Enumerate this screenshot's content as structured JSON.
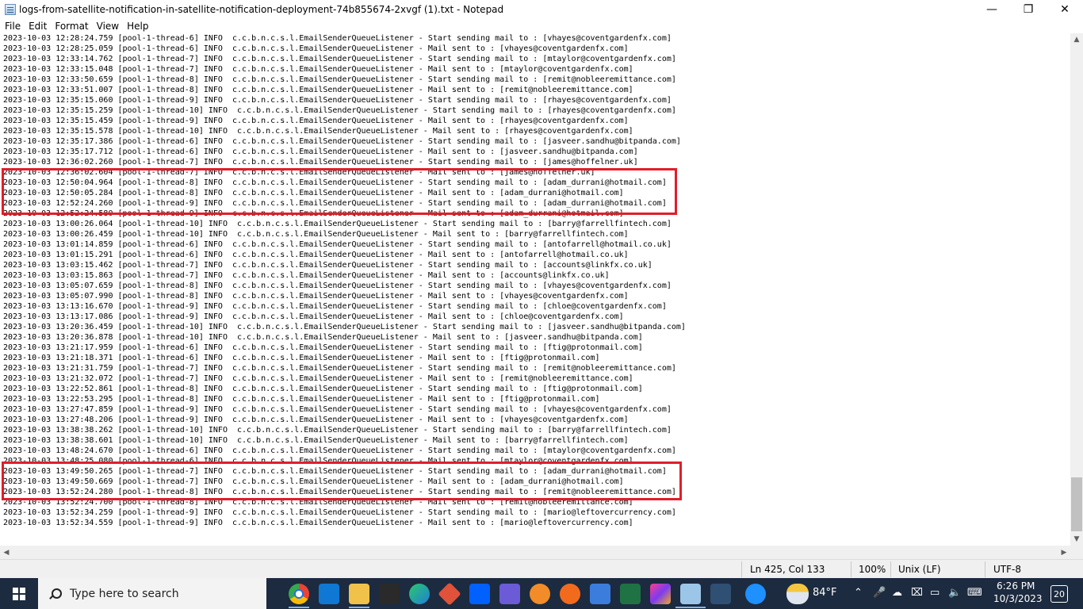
{
  "window": {
    "title": "logs-from-satellite-notification-in-satellite-notification-deployment-74b855674-2xvgf (1).txt - Notepad",
    "minimize_glyph": "—",
    "maximize_glyph": "❐",
    "close_glyph": "✕"
  },
  "menu": [
    "File",
    "Edit",
    "Format",
    "View",
    "Help"
  ],
  "lines": [
    "2023-10-03 12:28:24.759 [pool-1-thread-6] INFO  c.c.b.n.c.s.l.EmailSenderQueueListener - Start sending mail to : [vhayes@coventgardenfx.com]",
    "2023-10-03 12:28:25.059 [pool-1-thread-6] INFO  c.c.b.n.c.s.l.EmailSenderQueueListener - Mail sent to : [vhayes@coventgardenfx.com]",
    "2023-10-03 12:33:14.762 [pool-1-thread-7] INFO  c.c.b.n.c.s.l.EmailSenderQueueListener - Start sending mail to : [mtaylor@coventgardenfx.com]",
    "2023-10-03 12:33:15.048 [pool-1-thread-7] INFO  c.c.b.n.c.s.l.EmailSenderQueueListener - Mail sent to : [mtaylor@coventgardenfx.com]",
    "2023-10-03 12:33:50.659 [pool-1-thread-8] INFO  c.c.b.n.c.s.l.EmailSenderQueueListener - Start sending mail to : [remit@nobleeremittance.com]",
    "2023-10-03 12:33:51.007 [pool-1-thread-8] INFO  c.c.b.n.c.s.l.EmailSenderQueueListener - Mail sent to : [remit@nobleeremittance.com]",
    "2023-10-03 12:35:15.060 [pool-1-thread-9] INFO  c.c.b.n.c.s.l.EmailSenderQueueListener - Start sending mail to : [rhayes@coventgardenfx.com]",
    "2023-10-03 12:35:15.259 [pool-1-thread-10] INFO  c.c.b.n.c.s.l.EmailSenderQueueListener - Start sending mail to : [rhayes@coventgardenfx.com]",
    "2023-10-03 12:35:15.459 [pool-1-thread-9] INFO  c.c.b.n.c.s.l.EmailSenderQueueListener - Mail sent to : [rhayes@coventgardenfx.com]",
    "2023-10-03 12:35:15.578 [pool-1-thread-10] INFO  c.c.b.n.c.s.l.EmailSenderQueueListener - Mail sent to : [rhayes@coventgardenfx.com]",
    "2023-10-03 12:35:17.386 [pool-1-thread-6] INFO  c.c.b.n.c.s.l.EmailSenderQueueListener - Start sending mail to : [jasveer.sandhu@bitpanda.com]",
    "2023-10-03 12:35:17.712 [pool-1-thread-6] INFO  c.c.b.n.c.s.l.EmailSenderQueueListener - Mail sent to : [jasveer.sandhu@bitpanda.com]",
    "2023-10-03 12:36:02.260 [pool-1-thread-7] INFO  c.c.b.n.c.s.l.EmailSenderQueueListener - Start sending mail to : [james@hoffelner.uk]",
    "2023-10-03 12:36:02.604 [pool-1-thread-7] INFO  c.c.b.n.c.s.l.EmailSenderQueueListener - Mail sent to : [james@hoffelner.uk]",
    "2023-10-03 12:50:04.964 [pool-1-thread-8] INFO  c.c.b.n.c.s.l.EmailSenderQueueListener - Start sending mail to : [adam_durrani@hotmail.com]",
    "2023-10-03 12:50:05.284 [pool-1-thread-8] INFO  c.c.b.n.c.s.l.EmailSenderQueueListener - Mail sent to : [adam_durrani@hotmail.com]",
    "2023-10-03 12:52:24.260 [pool-1-thread-9] INFO  c.c.b.n.c.s.l.EmailSenderQueueListener - Start sending mail to : [adam_durrani@hotmail.com]",
    "2023-10-03 12:52:24.580 [pool-1-thread-9] INFO  c.c.b.n.c.s.l.EmailSenderQueueListener - Mail sent to : [adam_durrani@hotmail.com]",
    "2023-10-03 13:00:26.064 [pool-1-thread-10] INFO  c.c.b.n.c.s.l.EmailSenderQueueListener - Start sending mail to : [barry@farrellfintech.com]",
    "2023-10-03 13:00:26.459 [pool-1-thread-10] INFO  c.c.b.n.c.s.l.EmailSenderQueueListener - Mail sent to : [barry@farrellfintech.com]",
    "2023-10-03 13:01:14.859 [pool-1-thread-6] INFO  c.c.b.n.c.s.l.EmailSenderQueueListener - Start sending mail to : [antofarrell@hotmail.co.uk]",
    "2023-10-03 13:01:15.291 [pool-1-thread-6] INFO  c.c.b.n.c.s.l.EmailSenderQueueListener - Mail sent to : [antofarrell@hotmail.co.uk]",
    "2023-10-03 13:03:15.462 [pool-1-thread-7] INFO  c.c.b.n.c.s.l.EmailSenderQueueListener - Start sending mail to : [accounts@linkfx.co.uk]",
    "2023-10-03 13:03:15.863 [pool-1-thread-7] INFO  c.c.b.n.c.s.l.EmailSenderQueueListener - Mail sent to : [accounts@linkfx.co.uk]",
    "2023-10-03 13:05:07.659 [pool-1-thread-8] INFO  c.c.b.n.c.s.l.EmailSenderQueueListener - Start sending mail to : [vhayes@coventgardenfx.com]",
    "2023-10-03 13:05:07.990 [pool-1-thread-8] INFO  c.c.b.n.c.s.l.EmailSenderQueueListener - Mail sent to : [vhayes@coventgardenfx.com]",
    "2023-10-03 13:13:16.670 [pool-1-thread-9] INFO  c.c.b.n.c.s.l.EmailSenderQueueListener - Start sending mail to : [chloe@coventgardenfx.com]",
    "2023-10-03 13:13:17.086 [pool-1-thread-9] INFO  c.c.b.n.c.s.l.EmailSenderQueueListener - Mail sent to : [chloe@coventgardenfx.com]",
    "2023-10-03 13:20:36.459 [pool-1-thread-10] INFO  c.c.b.n.c.s.l.EmailSenderQueueListener - Start sending mail to : [jasveer.sandhu@bitpanda.com]",
    "2023-10-03 13:20:36.878 [pool-1-thread-10] INFO  c.c.b.n.c.s.l.EmailSenderQueueListener - Mail sent to : [jasveer.sandhu@bitpanda.com]",
    "2023-10-03 13:21:17.959 [pool-1-thread-6] INFO  c.c.b.n.c.s.l.EmailSenderQueueListener - Start sending mail to : [ftig@protonmail.com]",
    "2023-10-03 13:21:18.371 [pool-1-thread-6] INFO  c.c.b.n.c.s.l.EmailSenderQueueListener - Mail sent to : [ftig@protonmail.com]",
    "2023-10-03 13:21:31.759 [pool-1-thread-7] INFO  c.c.b.n.c.s.l.EmailSenderQueueListener - Start sending mail to : [remit@nobleeremittance.com]",
    "2023-10-03 13:21:32.072 [pool-1-thread-7] INFO  c.c.b.n.c.s.l.EmailSenderQueueListener - Mail sent to : [remit@nobleeremittance.com]",
    "2023-10-03 13:22:52.861 [pool-1-thread-8] INFO  c.c.b.n.c.s.l.EmailSenderQueueListener - Start sending mail to : [ftig@protonmail.com]",
    "2023-10-03 13:22:53.295 [pool-1-thread-8] INFO  c.c.b.n.c.s.l.EmailSenderQueueListener - Mail sent to : [ftig@protonmail.com]",
    "2023-10-03 13:27:47.859 [pool-1-thread-9] INFO  c.c.b.n.c.s.l.EmailSenderQueueListener - Start sending mail to : [vhayes@coventgardenfx.com]",
    "2023-10-03 13:27:48.206 [pool-1-thread-9] INFO  c.c.b.n.c.s.l.EmailSenderQueueListener - Mail sent to : [vhayes@coventgardenfx.com]",
    "2023-10-03 13:38:38.262 [pool-1-thread-10] INFO  c.c.b.n.c.s.l.EmailSenderQueueListener - Start sending mail to : [barry@farrellfintech.com]",
    "2023-10-03 13:38:38.601 [pool-1-thread-10] INFO  c.c.b.n.c.s.l.EmailSenderQueueListener - Mail sent to : [barry@farrellfintech.com]",
    "2023-10-03 13:48:24.670 [pool-1-thread-6] INFO  c.c.b.n.c.s.l.EmailSenderQueueListener - Start sending mail to : [mtaylor@coventgardenfx.com]",
    "2023-10-03 13:48:25.080 [pool-1-thread-6] INFO  c.c.b.n.c.s.l.EmailSenderQueueListener - Mail sent to : [mtaylor@coventgardenfx.com]",
    "2023-10-03 13:49:50.265 [pool-1-thread-7] INFO  c.c.b.n.c.s.l.EmailSenderQueueListener - Start sending mail to : [adam_durrani@hotmail.com]",
    "2023-10-03 13:49:50.669 [pool-1-thread-7] INFO  c.c.b.n.c.s.l.EmailSenderQueueListener - Mail sent to : [adam_durrani@hotmail.com]",
    "2023-10-03 13:52:24.280 [pool-1-thread-8] INFO  c.c.b.n.c.s.l.EmailSenderQueueListener - Start sending mail to : [remit@nobleeremittance.com]",
    "2023-10-03 13:52:24.700 [pool-1-thread-8] INFO  c.c.b.n.c.s.l.EmailSenderQueueListener - Mail sent to : [remit@nobleeremittance.com]",
    "2023-10-03 13:52:34.259 [pool-1-thread-9] INFO  c.c.b.n.c.s.l.EmailSenderQueueListener - Start sending mail to : [mario@leftovercurrency.com]",
    "2023-10-03 13:52:34.559 [pool-1-thread-9] INFO  c.c.b.n.c.s.l.EmailSenderQueueListener - Mail sent to : [mario@leftovercurrency.com]"
  ],
  "highlight_color": "#e01e2a",
  "status": {
    "position": "Ln 425, Col 133",
    "zoom": "100%",
    "line_ending": "Unix (LF)",
    "encoding": "UTF-8"
  },
  "taskbar": {
    "search_placeholder": "Type here to search",
    "pinned_icons": [
      "chrome-icon",
      "mail-icon",
      "file-explorer-icon",
      "app-icon",
      "edge-icon",
      "git-icon",
      "dropbox-icon",
      "app-icon",
      "app-icon",
      "app-icon",
      "app-icon",
      "excel-icon",
      "intellij-icon",
      "notepad-icon",
      "app-icon",
      "help-icon"
    ],
    "weather_temp": "84°F",
    "time": "6:26 PM",
    "date": "10/3/2023",
    "notification_count": "20"
  }
}
